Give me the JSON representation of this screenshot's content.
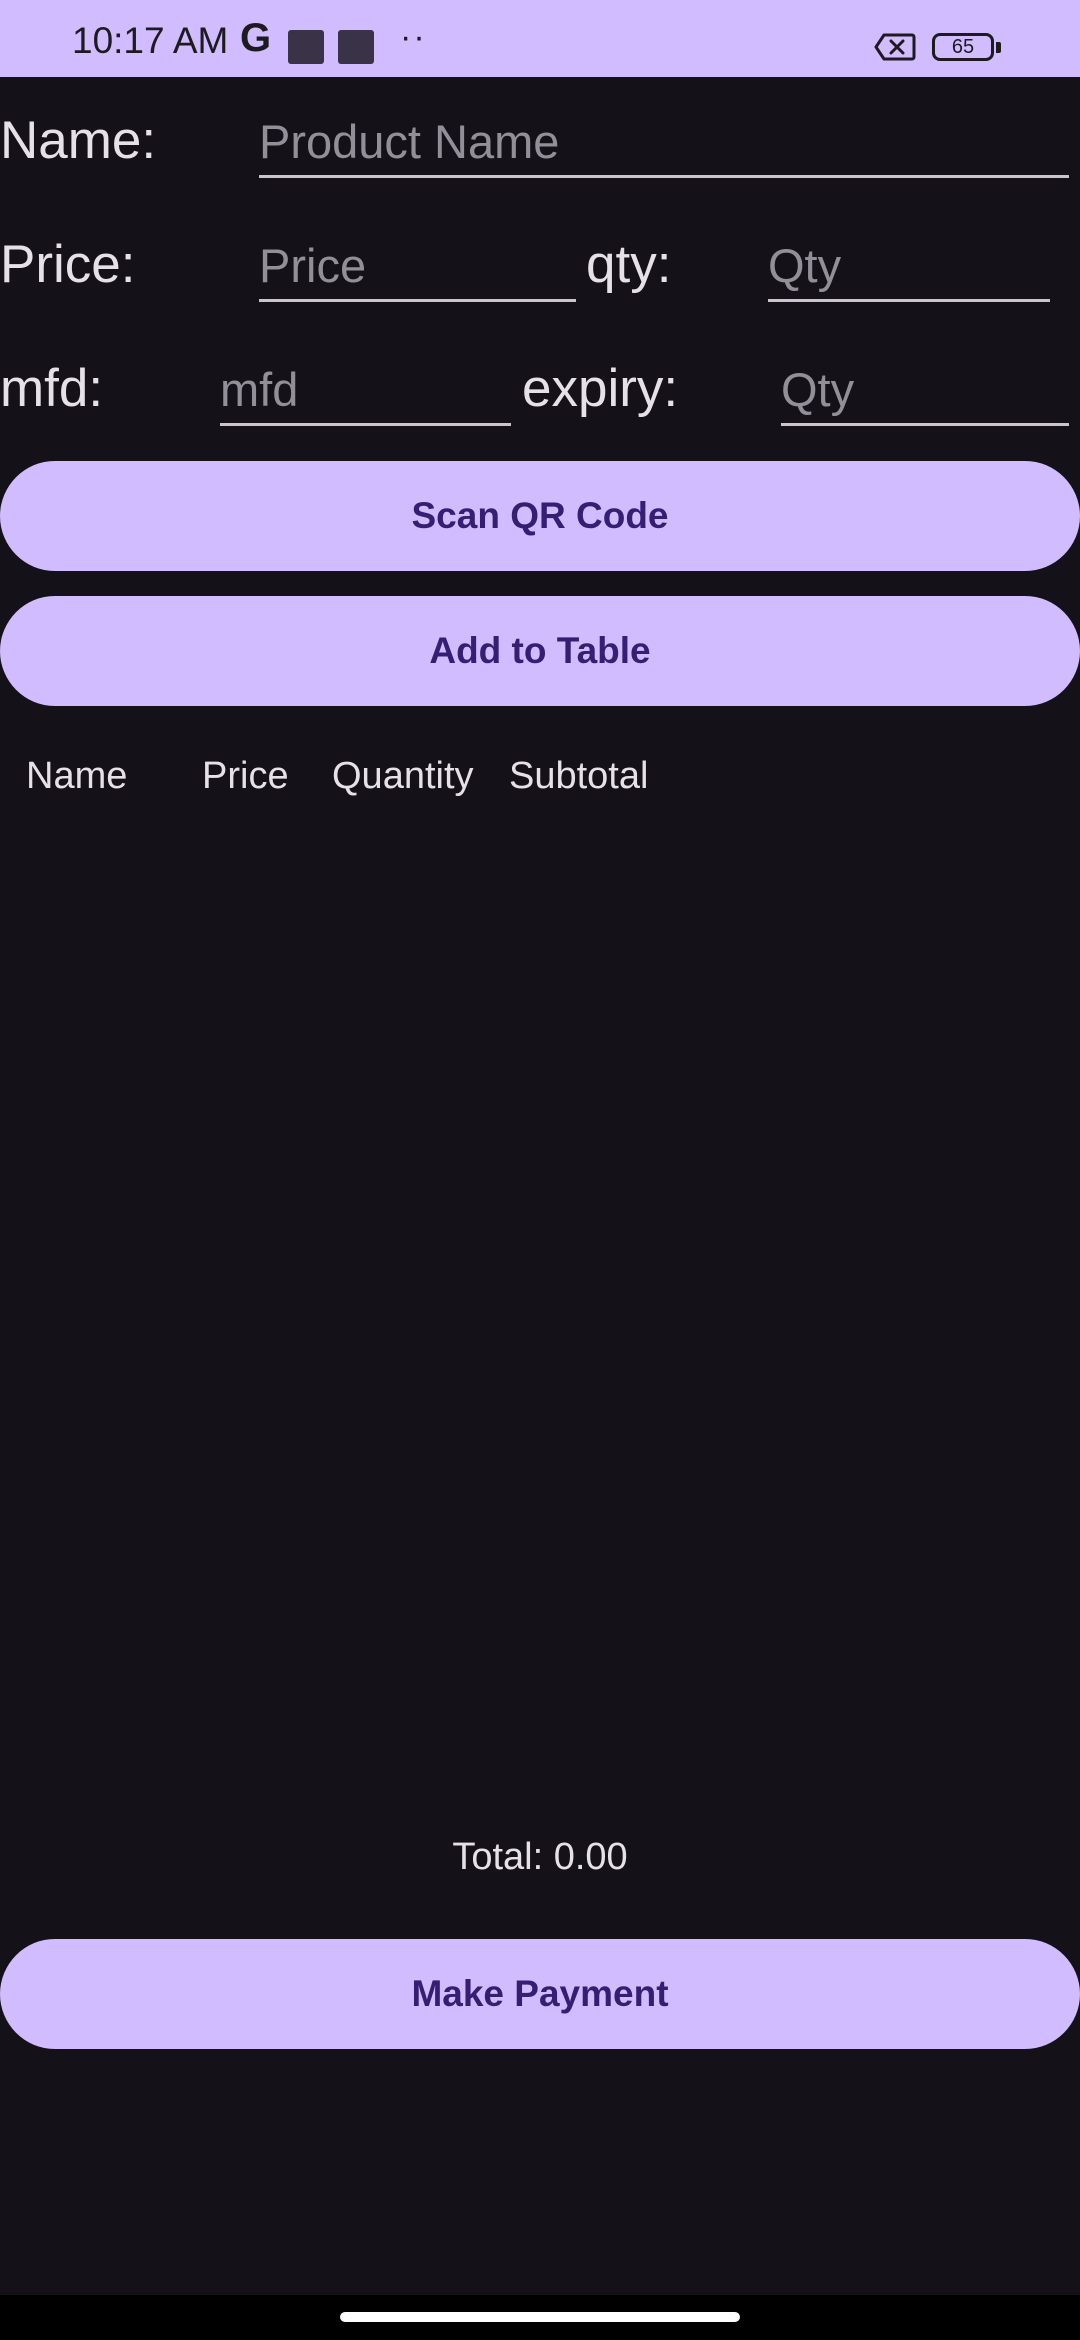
{
  "status_bar": {
    "time": "10:17 AM",
    "carrier_glyph": "G",
    "dots": "··",
    "battery_level": "65",
    "icons": [
      "g-icon",
      "notification-square-icon",
      "notification-square-icon",
      "more-dots-icon",
      "no-sim-icon",
      "battery-icon"
    ]
  },
  "form": {
    "name_label": "Name:",
    "name_placeholder": "Product Name",
    "name_value": "",
    "price_label": "Price:",
    "price_placeholder": "Price",
    "price_value": "",
    "qty_label": "qty:",
    "qty_placeholder": "Qty",
    "qty_value": "",
    "mfd_label": "mfd:",
    "mfd_placeholder": "mfd",
    "mfd_value": "",
    "expiry_label": "expiry:",
    "expiry_placeholder": "Qty",
    "expiry_value": ""
  },
  "buttons": {
    "scan_qr": "Scan QR Code",
    "add_to_table": "Add to Table",
    "make_payment": "Make Payment"
  },
  "table": {
    "columns": [
      "Name",
      "Price",
      "Quantity",
      "Subtotal"
    ],
    "rows": []
  },
  "total": "Total: 0.00",
  "colors": {
    "background": "#141218",
    "accent": "#D0BCFF",
    "on_accent": "#381E72",
    "text": "#E6E0E9",
    "hint": "#938F99"
  }
}
